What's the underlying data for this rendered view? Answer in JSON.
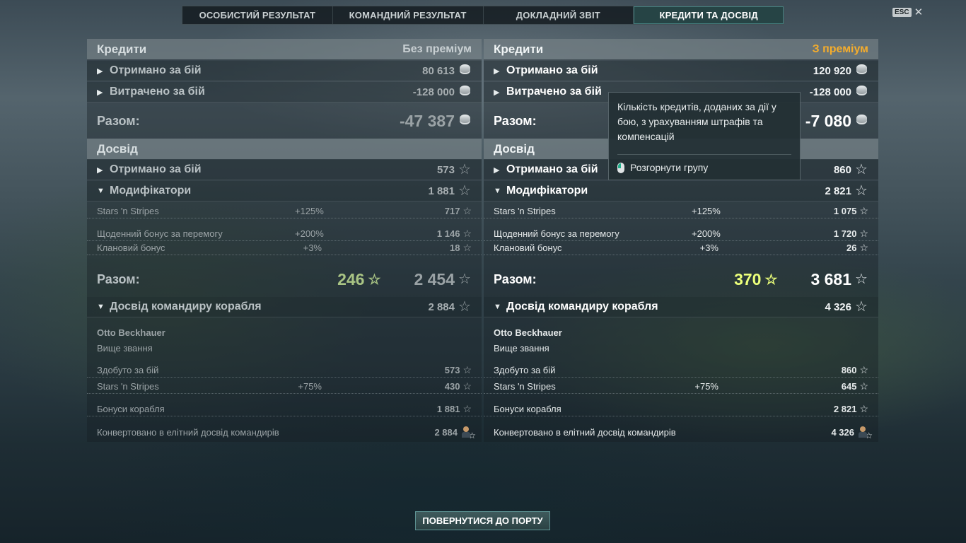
{
  "tabs": [
    "ОСОБИСТИЙ РЕЗУЛЬТАТ",
    "КОМАНДНИЙ РЕЗУЛЬТАТ",
    "ДОКЛАДНИЙ ЗВІТ",
    "КРЕДИТИ ТА ДОСВІД"
  ],
  "active_tab": "КРЕДИТИ ТА ДОСВІД",
  "esc_label": "ESC",
  "close_glyph": "✕",
  "left": {
    "credits_title": "Кредити",
    "premium_status": "Без преміум",
    "earned_label": "Отримано за бій",
    "earned_value": "80 613",
    "spent_label": "Витрачено за бій",
    "spent_value": "-128 000",
    "credits_total_label": "Разом:",
    "credits_total": "-47 387",
    "exp_title": "Досвід",
    "exp_earned_label": "Отримано за бій",
    "exp_earned_value": "573",
    "modifiers_label": "Модифікатори",
    "modifiers_value": "1 881",
    "mods": [
      {
        "name": "Stars 'n Stripes",
        "pct": "+125%",
        "value": "717"
      },
      {
        "name": "Щоденний бонус за перемогу",
        "pct": "+200%",
        "value": "1 146"
      },
      {
        "name": "Клановий бонус",
        "pct": "+3%",
        "value": "18"
      }
    ],
    "exp_total_label": "Разом:",
    "free_exp": "246",
    "exp_total": "2 454",
    "cmd_label": "Досвід командиру корабля",
    "cmd_value": "2 884",
    "cmd_name": "Otto Beckhauer",
    "cmd_rank": "Вище звання",
    "cmd_rows": [
      {
        "name": "Здобуто за бій",
        "pct": "",
        "value": "573"
      },
      {
        "name": "Stars 'n Stripes",
        "pct": "+75%",
        "value": "430"
      },
      {
        "name": "Бонуси корабля",
        "pct": "",
        "value": "1 881"
      },
      {
        "name": "Конвертовано в елітний досвід командирів",
        "pct": "",
        "value": "2 884"
      }
    ]
  },
  "right": {
    "credits_title": "Кредити",
    "premium_status": "З преміум",
    "earned_label": "Отримано за бій",
    "earned_value": "120 920",
    "spent_label": "Витрачено за бій",
    "spent_value": "-128 000",
    "credits_total_label": "Разом:",
    "credits_total": "-7 080",
    "exp_title": "Досвід",
    "exp_earned_label": "Отримано за бій",
    "exp_earned_value": "860",
    "modifiers_label": "Модифікатори",
    "modifiers_value": "2 821",
    "mods": [
      {
        "name": "Stars 'n Stripes",
        "pct": "+125%",
        "value": "1 075"
      },
      {
        "name": "Щоденний бонус за перемогу",
        "pct": "+200%",
        "value": "1 720"
      },
      {
        "name": "Клановий бонус",
        "pct": "+3%",
        "value": "26"
      }
    ],
    "exp_total_label": "Разом:",
    "free_exp": "370",
    "exp_total": "3 681",
    "cmd_label": "Досвід командиру корабля",
    "cmd_value": "4 326",
    "cmd_name": "Otto Beckhauer",
    "cmd_rank": "Вище звання",
    "cmd_rows": [
      {
        "name": "Здобуто за бій",
        "pct": "",
        "value": "860"
      },
      {
        "name": "Stars 'n Stripes",
        "pct": "+75%",
        "value": "645"
      },
      {
        "name": "Бонуси корабля",
        "pct": "",
        "value": "2 821"
      },
      {
        "name": "Конвертовано в елітний досвід командирів",
        "pct": "",
        "value": "4 326"
      }
    ]
  },
  "tooltip": {
    "text": "Кількість кредитів, доданих за дії у бою, з урахуванням штрафів та компенсацій",
    "hint": "Розгорнути групу"
  },
  "port_button": "ПОВЕРНУТИСЯ ДО ПОРТУ",
  "colors": {
    "premium": "#f5ad2c",
    "free_exp_premium": "#ecff7a",
    "free_exp_base": "#a9c484",
    "active_tab": "#284848"
  }
}
